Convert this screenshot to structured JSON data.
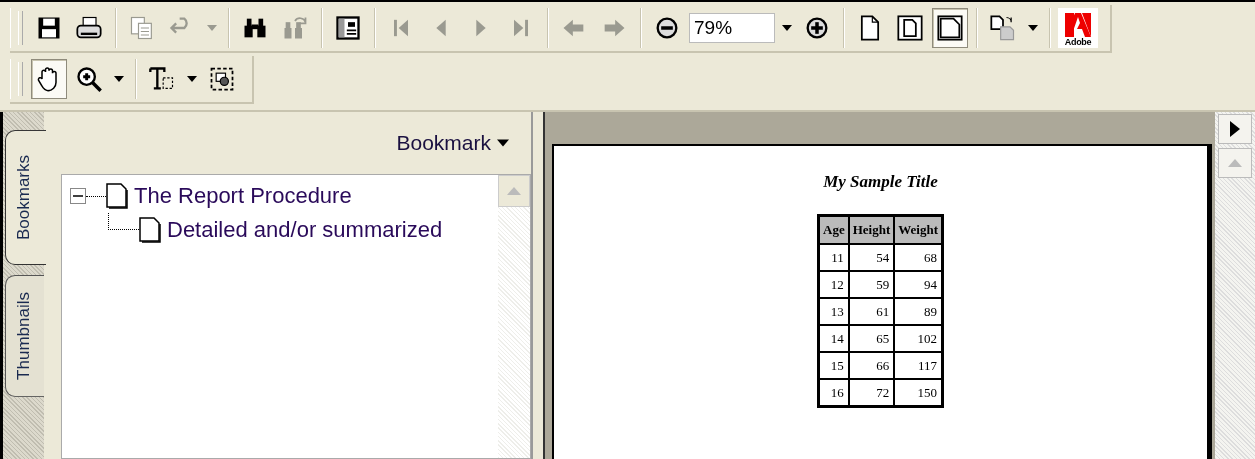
{
  "toolbars": [
    {
      "groups": [
        [
          {
            "kind": "button",
            "disabled": false,
            "selected": false
          },
          {
            "kind": "button",
            "disabled": false,
            "selected": false
          }
        ],
        [
          {
            "kind": "button",
            "disabled": true,
            "selected": false
          },
          {
            "kind": "button",
            "disabled": true,
            "selected": false
          },
          {
            "kind": "caret",
            "disabled": true
          }
        ],
        [
          {
            "kind": "button",
            "disabled": false,
            "selected": false
          },
          {
            "kind": "button",
            "disabled": true,
            "selected": false
          }
        ],
        [
          {
            "kind": "button",
            "disabled": false,
            "selected": false
          }
        ],
        [
          {
            "kind": "button",
            "disabled": true,
            "selected": false
          },
          {
            "kind": "button",
            "disabled": true,
            "selected": false
          },
          {
            "kind": "button",
            "disabled": true,
            "selected": false
          },
          {
            "kind": "button",
            "disabled": true,
            "selected": false
          }
        ],
        [
          {
            "kind": "button",
            "disabled": true,
            "selected": false
          },
          {
            "kind": "button",
            "disabled": true,
            "selected": false
          }
        ],
        [
          {
            "kind": "button",
            "disabled": false,
            "selected": false
          },
          {
            "kind": "field",
            "value": "79%"
          },
          {
            "kind": "caret",
            "disabled": false
          },
          {
            "kind": "button",
            "disabled": false,
            "selected": false
          }
        ],
        [
          {
            "kind": "button",
            "disabled": false,
            "selected": false
          },
          {
            "kind": "button",
            "disabled": false,
            "selected": false
          },
          {
            "kind": "button",
            "disabled": false,
            "selected": true
          }
        ],
        [
          {
            "kind": "button",
            "disabled": false,
            "selected": false
          },
          {
            "kind": "caret",
            "disabled": false
          }
        ],
        [
          {
            "kind": "logo",
            "label": "Adobe"
          }
        ]
      ]
    },
    {
      "groups": [
        [
          {
            "kind": "button",
            "disabled": false,
            "selected": true
          },
          {
            "kind": "button",
            "disabled": false,
            "selected": false
          },
          {
            "kind": "caret",
            "disabled": false
          }
        ],
        [
          {
            "kind": "button",
            "disabled": false,
            "selected": false
          },
          {
            "kind": "caret",
            "disabled": false
          },
          {
            "kind": "button",
            "disabled": false,
            "selected": false
          }
        ]
      ]
    }
  ],
  "navigation": {
    "tabs": [
      {
        "label": "Bookmarks",
        "selected": true
      },
      {
        "label": "Thumbnails",
        "selected": false
      }
    ],
    "menu": "Bookmark",
    "bookmarks": [
      {
        "label": "The Report Procedure",
        "expanded": true,
        "children": [
          {
            "label": "Detailed and/or summarized"
          }
        ]
      }
    ]
  },
  "document": {
    "title": "My Sample Title",
    "table": {
      "columns": [
        "Age",
        "Height",
        "Weight"
      ],
      "rows": [
        [
          "11",
          "54",
          "68"
        ],
        [
          "12",
          "59",
          "94"
        ],
        [
          "13",
          "61",
          "89"
        ],
        [
          "14",
          "65",
          "102"
        ],
        [
          "15",
          "66",
          "117"
        ],
        [
          "16",
          "72",
          "150"
        ]
      ]
    }
  }
}
